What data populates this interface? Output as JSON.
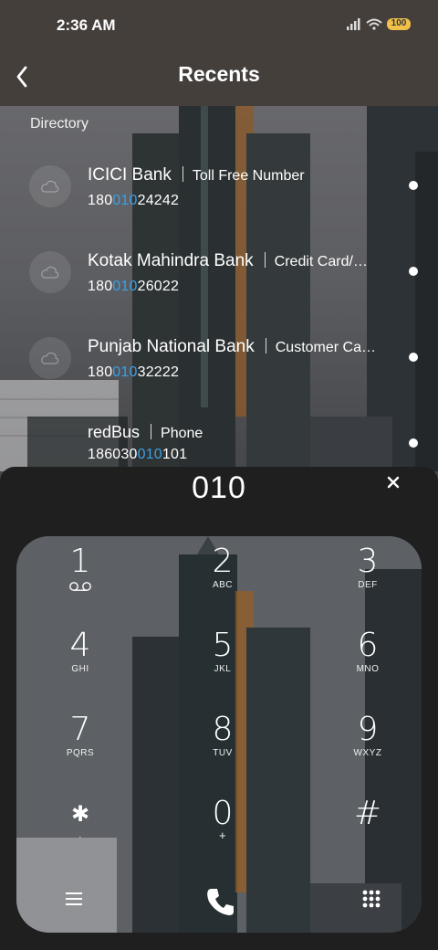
{
  "status_bar": {
    "time": "2:36 AM",
    "battery": "100",
    "icons": [
      "signal-icon",
      "wifi-icon",
      "battery-icon"
    ]
  },
  "header": {
    "title": "Recents",
    "back_icon": "back-arrow-icon"
  },
  "directory_label": "Directory",
  "contacts": [
    {
      "name": "ICICI Bank",
      "tag": "Toll Free Number",
      "number_pre": "180",
      "number_hl": "010",
      "number_post": "24242"
    },
    {
      "name": "Kotak Mahindra Bank",
      "tag": "Credit Card/…",
      "number_pre": "180",
      "number_hl": "010",
      "number_post": "26022"
    },
    {
      "name": "Punjab National Bank",
      "tag": "Customer Ca…",
      "number_pre": "180",
      "number_hl": "010",
      "number_post": "32222"
    },
    {
      "name": "redBus",
      "tag": "Phone",
      "number_pre": "186030",
      "number_hl": "010",
      "number_post": "101"
    }
  ],
  "dialer": {
    "input": "010",
    "keys": [
      {
        "digit": "1",
        "letters": ""
      },
      {
        "digit": "2",
        "letters": "ABC"
      },
      {
        "digit": "3",
        "letters": "DEF"
      },
      {
        "digit": "4",
        "letters": "GHI"
      },
      {
        "digit": "5",
        "letters": "JKL"
      },
      {
        "digit": "6",
        "letters": "MNO"
      },
      {
        "digit": "7",
        "letters": "PQRS"
      },
      {
        "digit": "8",
        "letters": "TUV"
      },
      {
        "digit": "9",
        "letters": "WXYZ"
      },
      {
        "digit": "✱",
        "letters": "·"
      },
      {
        "digit": "0",
        "letters": "+"
      },
      {
        "digit": "#",
        "letters": ""
      }
    ],
    "accent": "#3aa0e8"
  }
}
